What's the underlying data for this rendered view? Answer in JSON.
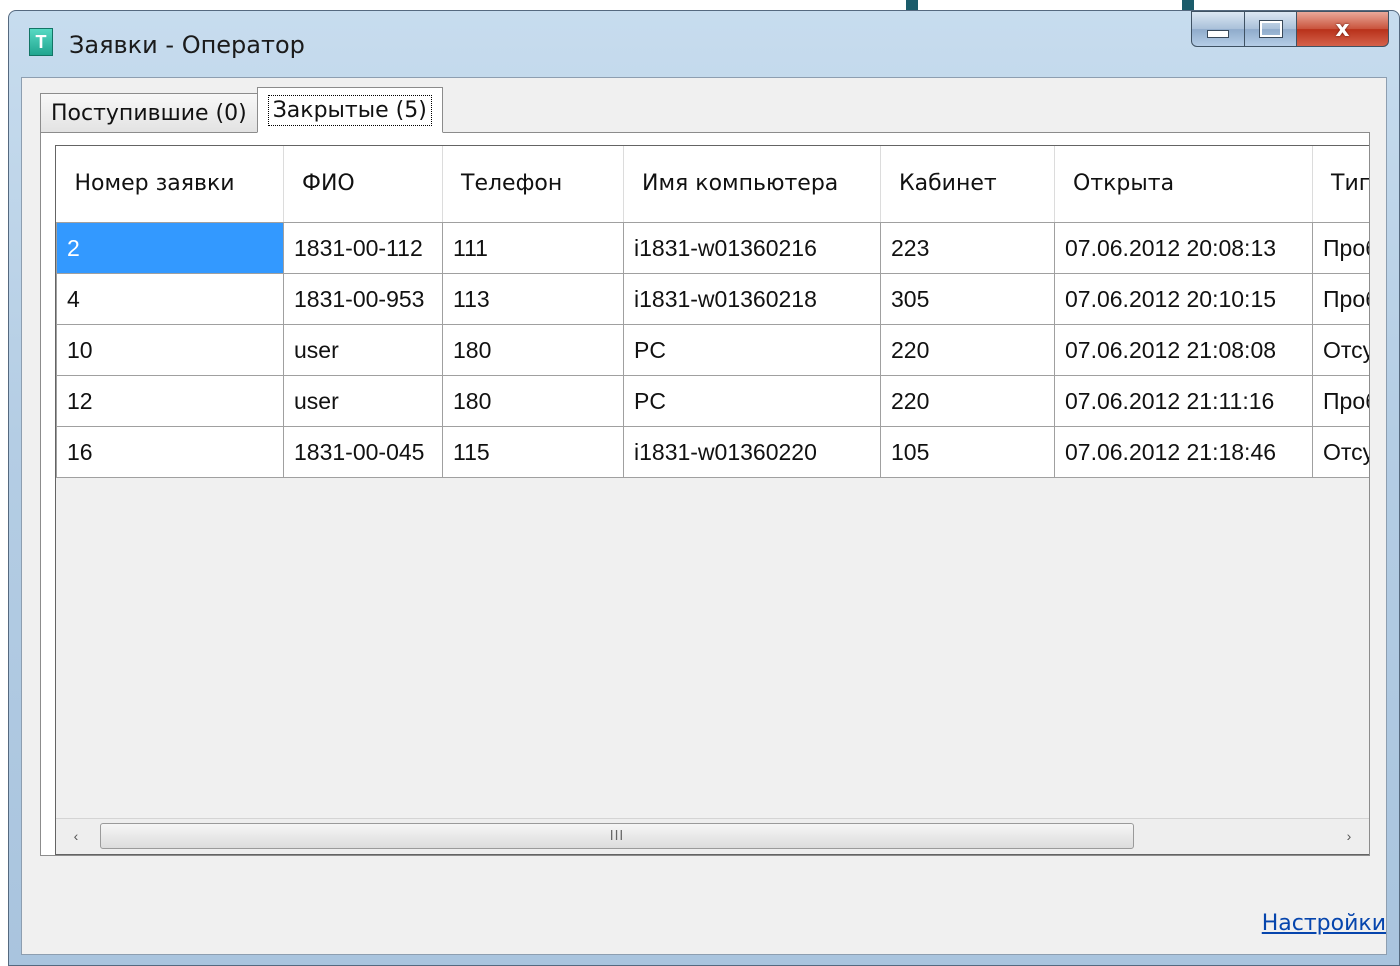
{
  "window": {
    "title": "Заявки - Оператор",
    "app_icon_letter": "T",
    "controls": {
      "minimize": "minimize",
      "maximize": "maximize",
      "close": "x"
    }
  },
  "tabs": [
    {
      "label": "Поступившие (0)",
      "active": false
    },
    {
      "label": "Закрытые (5)",
      "active": true
    }
  ],
  "grid": {
    "columns": [
      "Номер заявки",
      "ФИО",
      "Телефон",
      "Имя компьютера",
      "Кабинет",
      "Открыта",
      "Тип и"
    ],
    "rows": [
      [
        "2",
        "1831-00-112",
        "111",
        "i1831-w01360216",
        "223",
        "07.06.2012 20:08:13",
        "Пробл"
      ],
      [
        "4",
        "1831-00-953",
        "113",
        "i1831-w01360218",
        "305",
        "07.06.2012 20:10:15",
        "Пробл"
      ],
      [
        "10",
        "user",
        "180",
        "PC",
        "220",
        "07.06.2012 21:08:08",
        "Отсутс"
      ],
      [
        "12",
        "user",
        "180",
        "PC",
        "220",
        "07.06.2012 21:11:16",
        "Пробл"
      ],
      [
        "16",
        "1831-00-045",
        "115",
        "i1831-w01360220",
        "105",
        "07.06.2012 21:18:46",
        "Отсутс"
      ]
    ],
    "selected_cell": "2",
    "scrollbar": {
      "left_arrow": "‹",
      "right_arrow": "›",
      "grip": "III"
    }
  },
  "footer": {
    "settings_link": "Настройки"
  },
  "colors": {
    "selection": "#3399ff",
    "link": "#0645ad",
    "window_frame": "#b4cde4"
  }
}
